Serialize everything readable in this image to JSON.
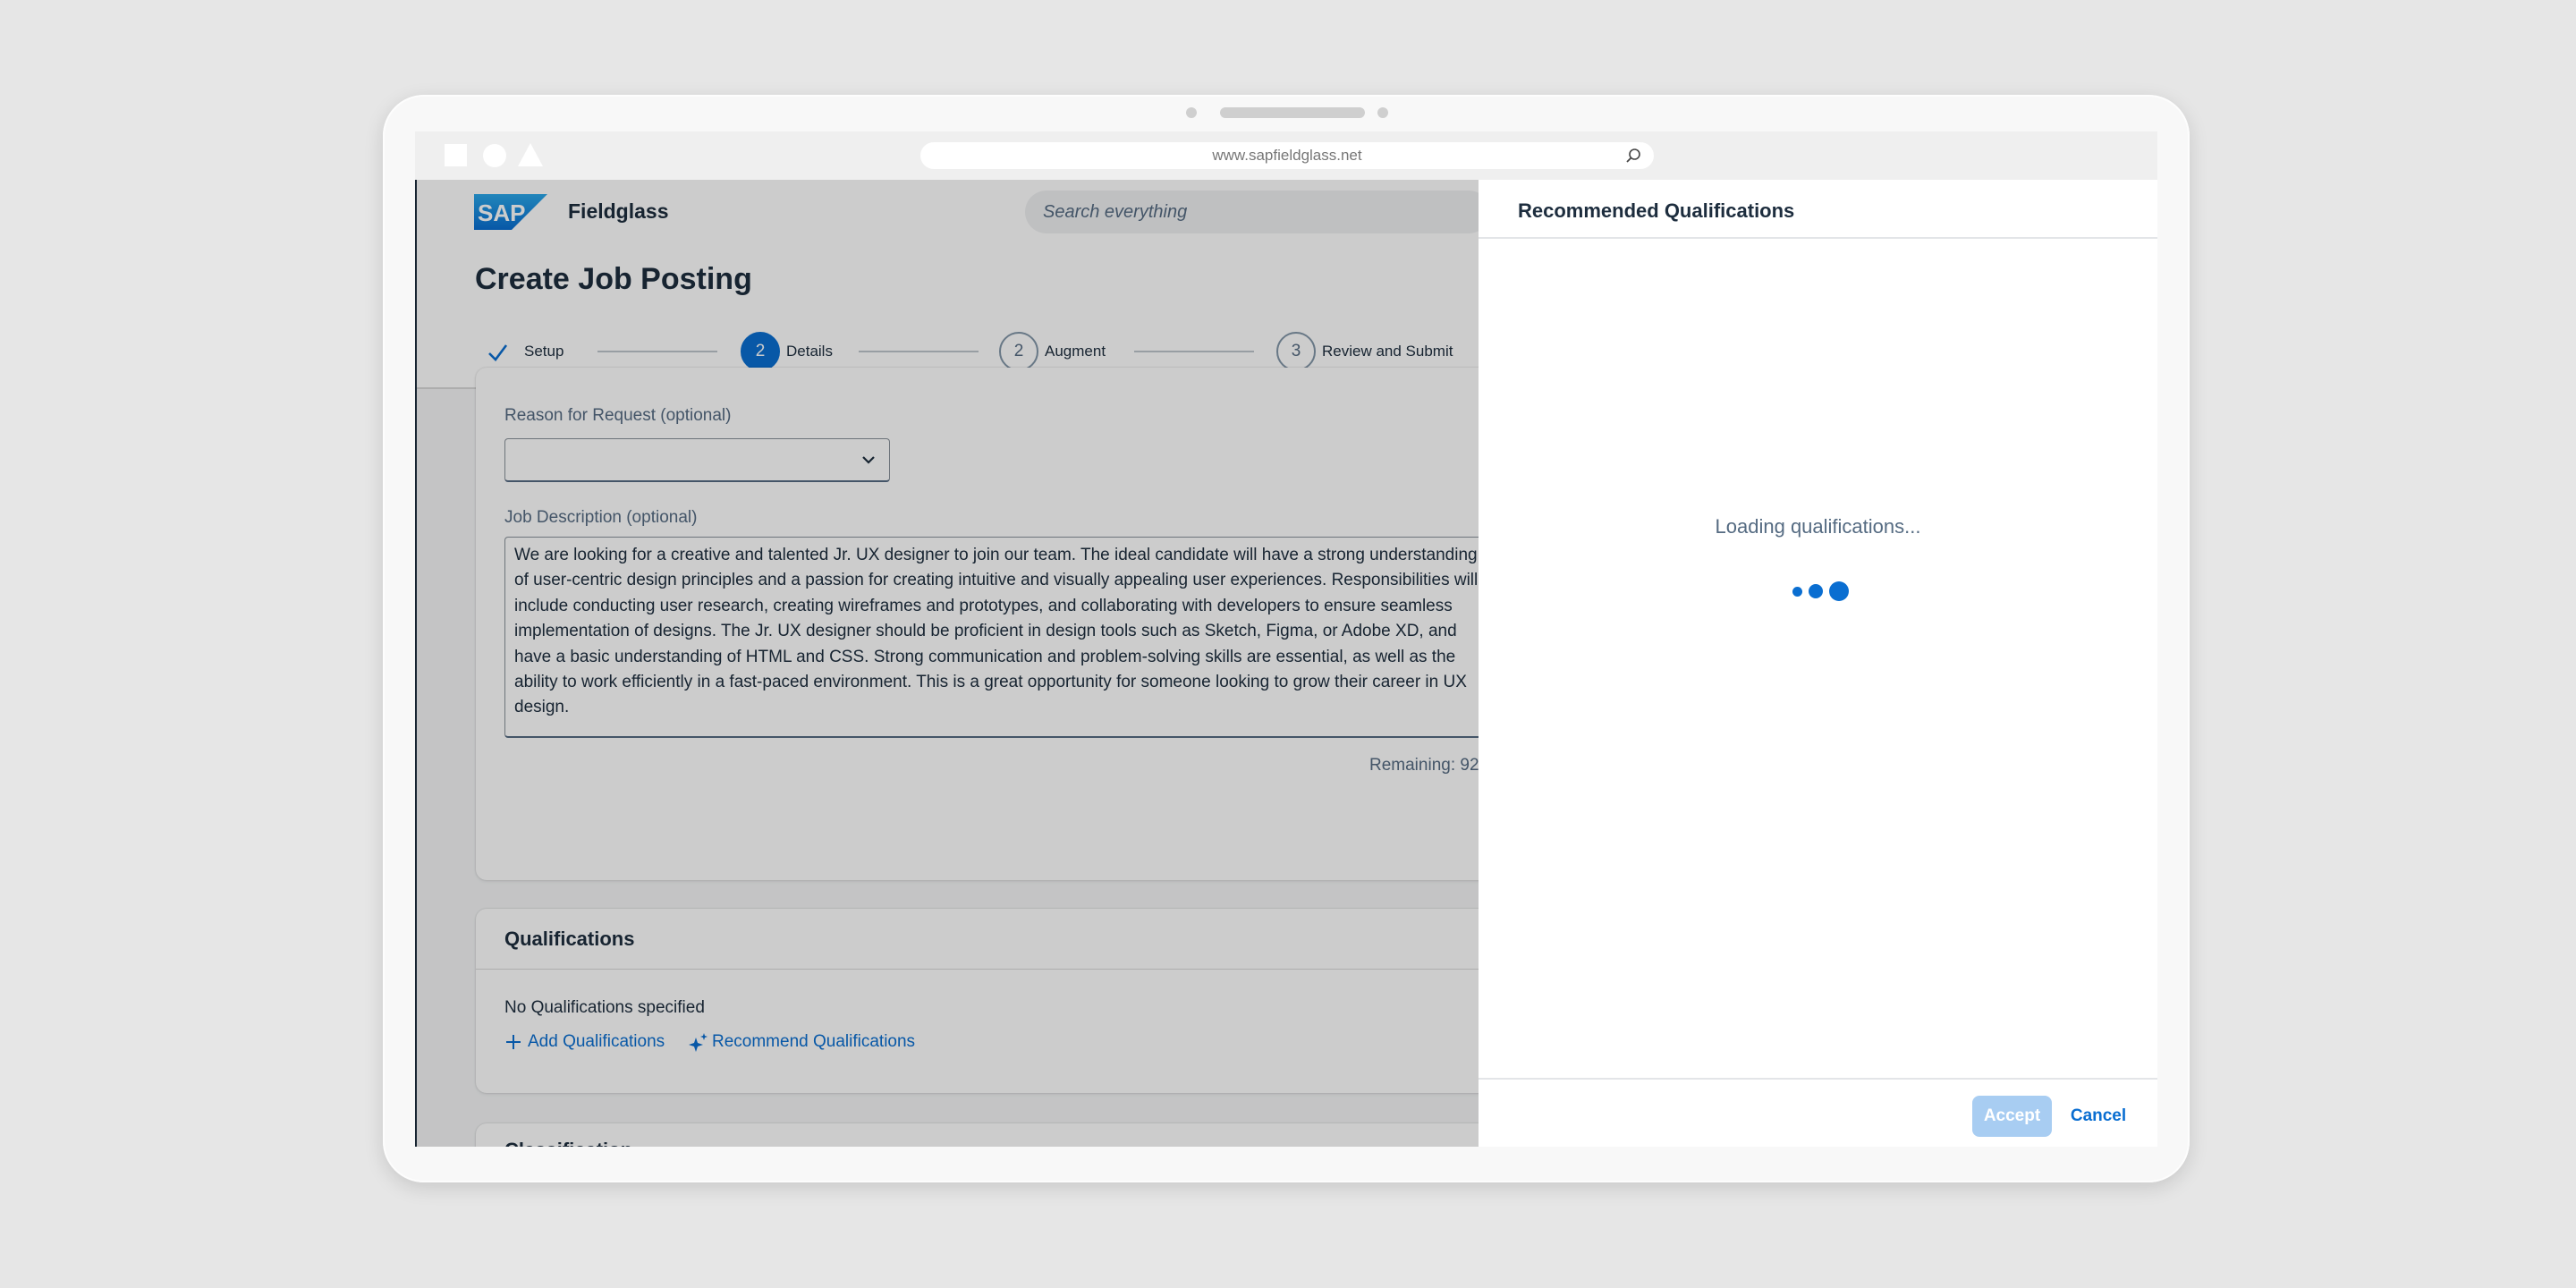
{
  "browser": {
    "url": "www.sapfieldglass.net"
  },
  "shell": {
    "logo_text": "SAP",
    "product": "Fieldglass",
    "search_placeholder": "Search everything"
  },
  "page": {
    "title": "Create Job Posting",
    "steps": [
      {
        "number": "",
        "label": "Setup",
        "state": "completed"
      },
      {
        "number": "2",
        "label": "Details",
        "state": "active"
      },
      {
        "number": "2",
        "label": "Augment",
        "state": "upcoming"
      },
      {
        "number": "3",
        "label": "Review and Submit",
        "state": "upcoming"
      }
    ]
  },
  "form": {
    "reason_label": "Reason for Request (optional)",
    "reason_value": "",
    "description_label": "Job Description (optional)",
    "description_text": "We are looking for a creative and talented Jr. UX designer to join our team. The ideal candidate will have a strong understanding of user-centric design principles and a passion for creating intuitive and visually appealing user experiences. Responsibilities will include conducting user research, creating wireframes and prototypes, and collaborating with developers to ensure seamless implementation of designs. The Jr. UX designer should be proficient in design tools such as Sketch, Figma, or Adobe XD, and have a basic understanding of HTML and CSS. Strong communication and problem-solving skills are essential, as well as the ability to work efficiently in a fast-paced environment. This is a great opportunity for someone looking to grow their career in UX design.",
    "remaining": "Remaining: 92"
  },
  "qualifications": {
    "title": "Qualifications",
    "empty_text": "No Qualifications specified",
    "add_link": "Add Qualifications",
    "recommend_link": "Recommend Qualifications"
  },
  "next_section": {
    "title": "Classification"
  },
  "panel": {
    "title": "Recommended Qualifications",
    "loading_text": "Loading qualifications...",
    "accept_label": "Accept",
    "cancel_label": "Cancel"
  },
  "colors": {
    "brand_blue": "#0a6ed1",
    "accept_disabled": "#a8cdf2",
    "text": "#1d2d3e"
  }
}
